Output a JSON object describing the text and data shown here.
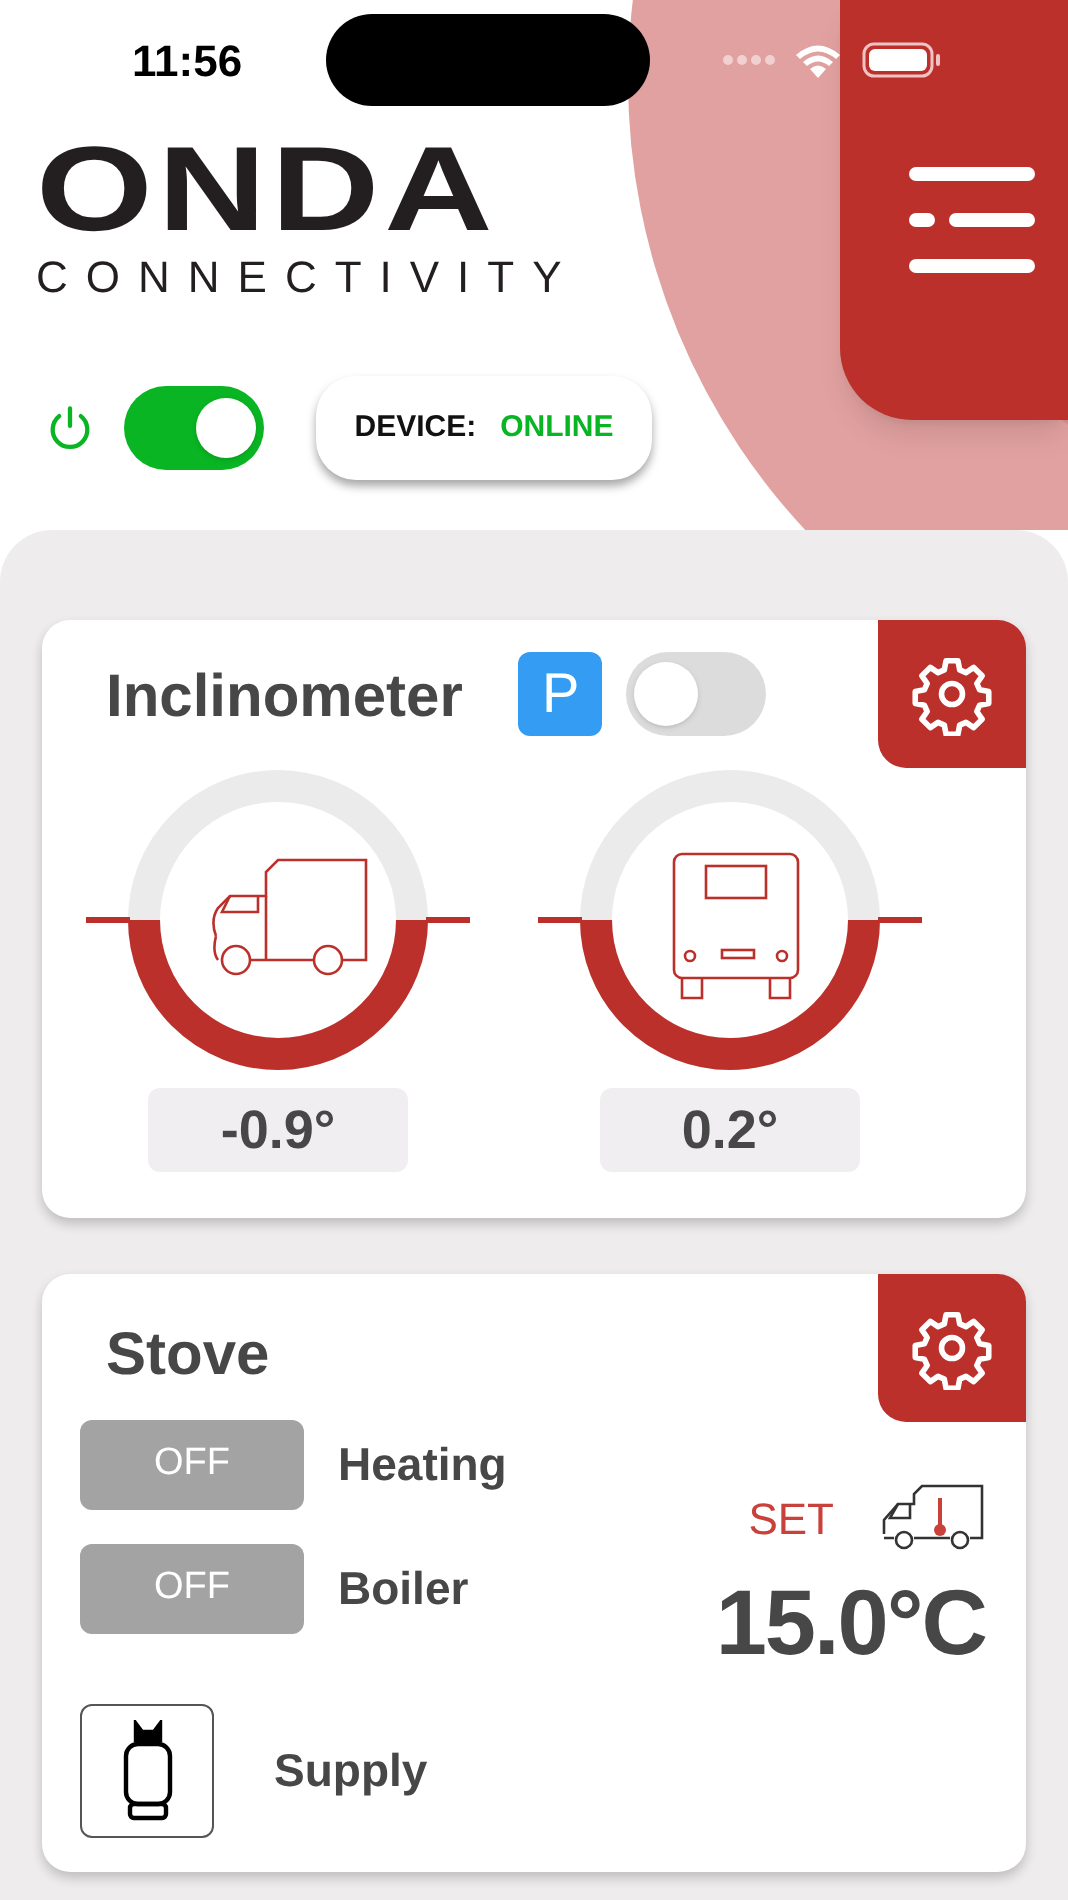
{
  "status_bar": {
    "time": "11:56"
  },
  "logo": {
    "name": "ONDA",
    "tagline": "CONNECTIVITY"
  },
  "power": {
    "on": true
  },
  "device_status": {
    "label": "DEVICE:",
    "value": "ONLINE"
  },
  "inclinometer": {
    "title": "Inclinometer",
    "park_badge": "P",
    "park_mode": {
      "on": false
    },
    "gauges": [
      {
        "kind": "side",
        "reading": "-0.9°"
      },
      {
        "kind": "rear",
        "reading": "0.2°"
      }
    ]
  },
  "stove": {
    "title": "Stove",
    "switches": [
      {
        "state": "OFF",
        "on": false,
        "label": "Heating"
      },
      {
        "state": "OFF",
        "on": false,
        "label": "Boiler"
      }
    ],
    "supply": {
      "label": "Supply"
    },
    "setpoint": {
      "label": "SET",
      "value": "15.0°C"
    }
  }
}
